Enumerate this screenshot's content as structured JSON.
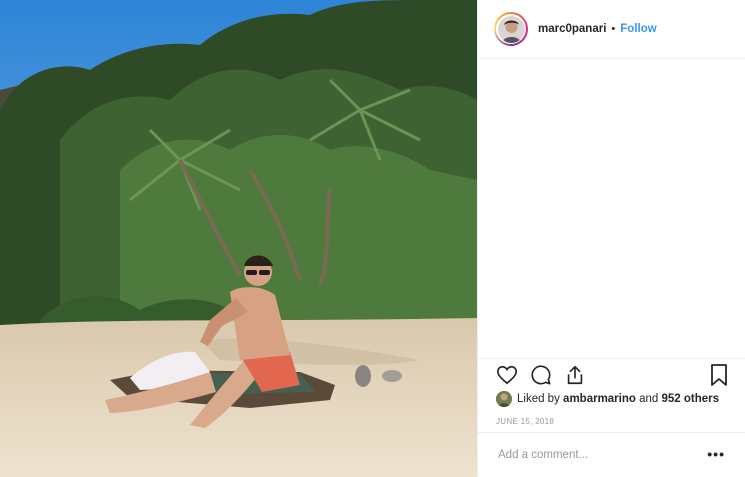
{
  "post": {
    "author": {
      "username": "marc0panari",
      "separator": "•",
      "follow_label": "Follow"
    },
    "photo": {
      "alt": "Man in sunglasses sitting on a towel on a sandy beach in front of tropical trees"
    },
    "actions": {
      "like_icon": "heart-icon",
      "comment_icon": "comment-icon",
      "share_icon": "share-icon",
      "save_icon": "bookmark-icon"
    },
    "likes": {
      "prefix": "Liked by",
      "user": "ambarmarino",
      "middle": "and",
      "others": "952 others"
    },
    "date": "JUNE 15, 2018",
    "comment": {
      "placeholder": "Add a comment...",
      "more_icon": "•••"
    },
    "colors": {
      "link": "#3897f0",
      "text": "#262626",
      "muted": "#999999",
      "divider": "#efefef"
    }
  }
}
